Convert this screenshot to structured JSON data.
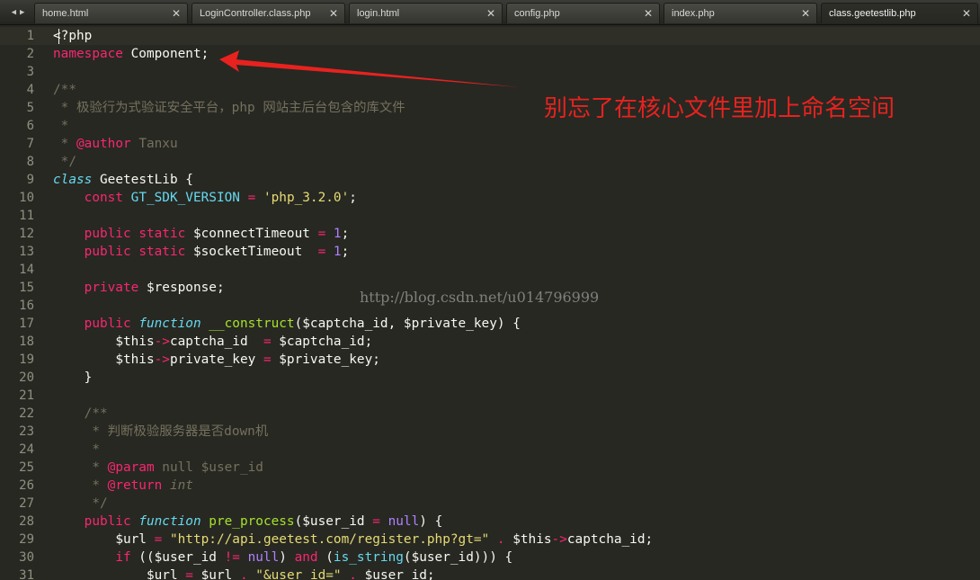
{
  "tabs": [
    {
      "label": "home.html",
      "active": false
    },
    {
      "label": "LoginController.class.php",
      "active": false
    },
    {
      "label": "login.html",
      "active": false
    },
    {
      "label": "config.php",
      "active": false
    },
    {
      "label": "index.php",
      "active": false
    },
    {
      "label": "class.geetestlib.php",
      "active": true
    }
  ],
  "icons": {
    "back": "arrow-left-icon",
    "forward": "arrow-right-icon",
    "close": "close-icon"
  },
  "editor": {
    "line_numbers": [
      "1",
      "2",
      "3",
      "4",
      "5",
      "6",
      "7",
      "8",
      "9",
      "10",
      "11",
      "12",
      "13",
      "14",
      "15",
      "16",
      "17",
      "18",
      "19",
      "20",
      "21",
      "22",
      "23",
      "24",
      "25",
      "26",
      "27",
      "28",
      "29",
      "30",
      "31"
    ],
    "code": {
      "l1": {
        "a": "<?php"
      },
      "l2": {
        "kw": "namespace",
        "rest": " Component;"
      },
      "l4": {
        "c": "/**"
      },
      "l5": {
        "c": " * 极验行为式验证安全平台，php 网站主后台包含的库文件"
      },
      "l6": {
        "c": " *"
      },
      "l7": {
        "c1": " * ",
        "tag": "@author",
        "c2": " Tanxu"
      },
      "l8": {
        "c": " */"
      },
      "l9": {
        "kw": "class",
        "sp": " ",
        "name": "GeetestLib",
        "rest": " {"
      },
      "l10": {
        "ind": "    ",
        "kw": "const",
        "sp": " ",
        "name": "GT_SDK_VERSION",
        "eq": " = ",
        "str": "'php_3.2.0'",
        "end": ";"
      },
      "l12": {
        "ind": "    ",
        "kw1": "public",
        "sp1": " ",
        "kw2": "static",
        "var": " $connectTimeout",
        "eq": " = ",
        "num": "1",
        "end": ";"
      },
      "l13": {
        "ind": "    ",
        "kw1": "public",
        "sp1": " ",
        "kw2": "static",
        "var": " $socketTimeout ",
        "eq": " = ",
        "num": "1",
        "end": ";"
      },
      "l15": {
        "ind": "    ",
        "kw": "private",
        "var": " $response;"
      },
      "l17": {
        "ind": "    ",
        "kw": "public",
        "sp": " ",
        "fn": "function",
        "sp2": " ",
        "name": "__construct",
        "rest": "($captcha_id, $private_key) {"
      },
      "l18": {
        "ind": "        ",
        "v1": "$this",
        "op": "->",
        "v2": "captcha_id  ",
        "eq": "=",
        "v3": " $captcha_id;"
      },
      "l19": {
        "ind": "        ",
        "v1": "$this",
        "op": "->",
        "v2": "private_key ",
        "eq": "=",
        "v3": " $private_key;"
      },
      "l20": {
        "a": "    }"
      },
      "l22": {
        "c": "    /**"
      },
      "l23": {
        "c": "     * 判断极验服务器是否down机"
      },
      "l24": {
        "c": "     *"
      },
      "l25": {
        "c1": "     * ",
        "tag": "@param",
        "c2": " null $user_id"
      },
      "l26": {
        "c1": "     * ",
        "tag": "@return",
        "c2": " int"
      },
      "l27": {
        "c": "     */"
      },
      "l28": {
        "ind": "    ",
        "kw": "public",
        "sp": " ",
        "fn": "function",
        "sp2": " ",
        "name": "pre_process",
        "p1": "($user_id ",
        "eq": "=",
        "sp3": " ",
        "null": "null",
        "rest": ") {"
      },
      "l29": {
        "ind": "        ",
        "v1": "$url ",
        "eq": "=",
        "sp": " ",
        "str": "\"http://api.geetest.com/register.php?gt=\"",
        "sp2": " ",
        "dot": ".",
        "v2": " $this",
        "op": "->",
        "v3": "captcha_id;"
      },
      "l30": {
        "ind": "        ",
        "kw": "if",
        "p1": " (($user_id ",
        "ne": "!=",
        "sp": " ",
        "null": "null",
        "p2": ") ",
        "and": "and",
        "p3": " (",
        "fn": "is_string",
        "p4": "($user_id))) {"
      },
      "l31": {
        "ind": "            ",
        "v1": "$url ",
        "eq": "=",
        "v2": " $url ",
        "dot": ".",
        "sp": " ",
        "str": "\"&user_id=\"",
        "sp2": " ",
        "dot2": ".",
        "v3": " $user_id;"
      }
    }
  },
  "watermark": "http://blog.csdn.net/u014796999",
  "annotation": "别忘了在核心文件里加上命名空间",
  "colors": {
    "background": "#272822",
    "keyword": "#f92672",
    "string": "#e6db74",
    "comment": "#75715e",
    "number": "#ae81ff",
    "function_name": "#a6e22e",
    "storage_type": "#66d9ef",
    "annotation": "#e8221f"
  }
}
